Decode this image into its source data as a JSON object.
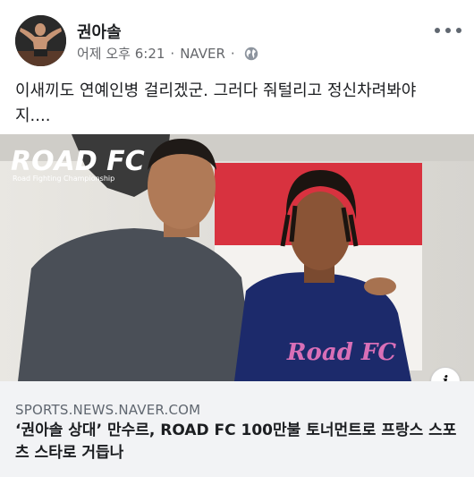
{
  "post": {
    "author": "권아솔",
    "time": "어제 오후 6:21",
    "source": "NAVER",
    "separator": "·",
    "body_line1": "이새끼도 연예인병 걸리겠군. 그러다 줘털리고 정신차려봐야",
    "body_line2": "지....",
    "privacy_icon": "globe-icon",
    "menu_icon": "more-options-icon"
  },
  "photo": {
    "logo_main": "ROAD FC",
    "logo_small": "Road Fighting Championship",
    "shirt_text": "Road FC"
  },
  "link": {
    "domain": "SPORTS.NEWS.NAVER.COM",
    "title": "‘권아솔 상대’ 만수르, ROAD FC 100만불 토너먼트로 프랑스 스포츠 스타로 거듭나",
    "info_icon": "info-icon",
    "info_glyph": "i"
  },
  "colors": {
    "meta_text": "#65676b",
    "link_bg": "#f2f3f5",
    "banner_red": "#d8323f"
  }
}
